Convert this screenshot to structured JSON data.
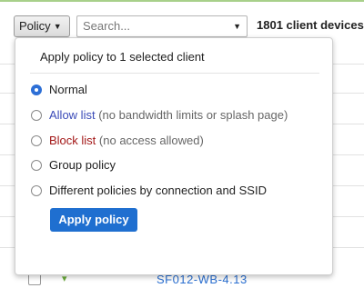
{
  "toolbar": {
    "policy_label": "Policy",
    "search_placeholder": "Search...",
    "client_count": "1801 client devices"
  },
  "popup": {
    "title": "Apply policy to 1 selected client",
    "options": [
      {
        "label": "Normal",
        "note": "",
        "selected": true,
        "color": "#222222"
      },
      {
        "label": "Allow list",
        "note": "(no bandwidth limits or splash page)",
        "selected": false,
        "color": "#3b4bb8"
      },
      {
        "label": "Block list",
        "note": "(no access allowed)",
        "selected": false,
        "color": "#a31818"
      },
      {
        "label": "Group policy",
        "note": "",
        "selected": false,
        "color": "#222222"
      },
      {
        "label": "Different policies by connection and SSID",
        "note": "",
        "selected": false,
        "color": "#222222"
      }
    ],
    "apply_label": "Apply policy"
  },
  "background": {
    "row_name": "SF012-WB-4.13"
  },
  "colors": {
    "accent": "#1f6fd0",
    "allow": "#3b4bb8",
    "block": "#a31818",
    "top_strip": "#a8d08a"
  }
}
